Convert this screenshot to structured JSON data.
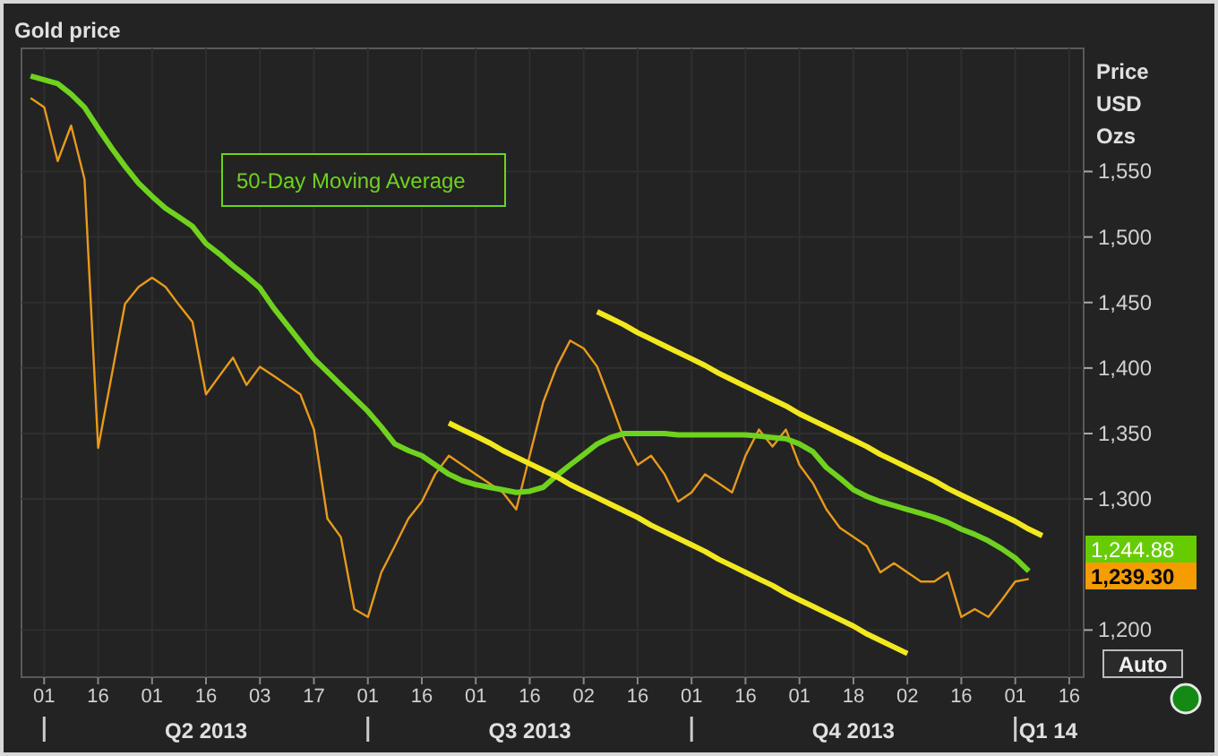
{
  "chart": {
    "axis_title": [
      "Price",
      "USD",
      "Ozs"
    ],
    "chart_data": {
      "type": "line",
      "title": "Gold price",
      "ylim": [
        1164,
        1644
      ],
      "categories": [
        null,
        "01",
        null,
        null,
        null,
        "16",
        null,
        null,
        null,
        "01",
        null,
        null,
        null,
        "16",
        null,
        null,
        null,
        "03",
        null,
        null,
        null,
        "17",
        null,
        null,
        null,
        "01",
        null,
        null,
        null,
        "16",
        null,
        null,
        null,
        "01",
        null,
        null,
        null,
        "16",
        null,
        null,
        null,
        "02",
        null,
        null,
        null,
        "16",
        null,
        null,
        null,
        "01",
        null,
        null,
        null,
        "16",
        null,
        null,
        null,
        "01",
        null,
        null,
        null,
        "18",
        null,
        null,
        null,
        "02",
        null,
        null,
        null,
        "16",
        null,
        null,
        null,
        "01",
        null,
        null,
        null,
        "16"
      ],
      "yticks": [
        {
          "value": 1200,
          "label": "1,200"
        },
        {
          "value": 1300,
          "label": "1,300"
        },
        {
          "value": 1350,
          "label": "1,350"
        },
        {
          "value": 1400,
          "label": "1,400"
        },
        {
          "value": 1450,
          "label": "1,450"
        },
        {
          "value": 1500,
          "label": "1,500"
        },
        {
          "value": 1550,
          "label": "1,550"
        }
      ],
      "series": [
        {
          "color": "#e89a1c",
          "values": [
            1606,
            1599,
            1558,
            1585,
            1544,
            1339,
            1394,
            1449,
            1462,
            1469,
            1462,
            1448,
            1435,
            1380,
            1394,
            1408,
            1387,
            1401,
            1394,
            1387,
            1380,
            1353,
            1285,
            1271,
            1216,
            1210,
            1244,
            1264,
            1285,
            1298,
            1319,
            1333,
            1326,
            1319,
            1312,
            1305,
            1292,
            1333,
            1374,
            1401,
            1421,
            1415,
            1401,
            1374,
            1346,
            1326,
            1333,
            1319,
            1298,
            1305,
            1319,
            1312,
            1305,
            1333,
            1353,
            1340,
            1353,
            1326,
            1312,
            1292,
            1278,
            1271,
            1264,
            1244,
            1251,
            1244,
            1237,
            1237,
            1244,
            1210,
            1216,
            1210,
            1223,
            1237,
            1239,
            null,
            null,
            null
          ]
        },
        {
          "name": "50-Day Moving Average",
          "color": "#6fd21e",
          "values": [
            1623,
            1620,
            1617,
            1609,
            1599,
            1583,
            1568,
            1554,
            1541,
            1531,
            1522,
            1515,
            1508,
            1495,
            1487,
            1478,
            1470,
            1461,
            1446,
            1433,
            1420,
            1407,
            1397,
            1387,
            1377,
            1367,
            1355,
            1342,
            1337,
            1333,
            1326,
            1319,
            1314,
            1311,
            1309,
            1307,
            1305,
            1306,
            1309,
            1318,
            1326,
            1334,
            1342,
            1347,
            1350,
            1350,
            1350,
            1350,
            1349,
            1349,
            1349,
            1349,
            1349,
            1349,
            1348,
            1347,
            1346,
            1342,
            1336,
            1324,
            1316,
            1307,
            1302,
            1298,
            1295,
            1292,
            1289,
            1286,
            1282,
            1277,
            1273,
            1268,
            1262,
            1255,
            1245,
            null,
            null,
            null
          ]
        },
        {
          "color": "#f2e81e",
          "values": [
            null,
            null,
            null,
            null,
            null,
            null,
            null,
            null,
            null,
            null,
            null,
            null,
            null,
            null,
            null,
            null,
            null,
            null,
            null,
            null,
            null,
            null,
            null,
            null,
            null,
            null,
            null,
            null,
            null,
            null,
            null,
            null,
            null,
            null,
            null,
            null,
            null,
            null,
            null,
            null,
            null,
            null,
            1443,
            1438,
            1433,
            1427,
            1422,
            1417,
            1412,
            1407,
            1402,
            1396,
            1391,
            1386,
            1381,
            1376,
            1371,
            1365,
            1360,
            1355,
            1350,
            1345,
            1340,
            1334,
            1329,
            1324,
            1319,
            1314,
            1308,
            1303,
            1298,
            1293,
            1288,
            1283,
            1277,
            1272,
            null,
            null
          ]
        },
        {
          "color": "#f2e81e",
          "values": [
            null,
            null,
            null,
            null,
            null,
            null,
            null,
            null,
            null,
            null,
            null,
            null,
            null,
            null,
            null,
            null,
            null,
            null,
            null,
            null,
            null,
            null,
            null,
            null,
            null,
            null,
            null,
            null,
            null,
            null,
            null,
            1358,
            1353,
            1348,
            1343,
            1337,
            1332,
            1327,
            1322,
            1317,
            1311,
            1306,
            1301,
            1296,
            1291,
            1286,
            1280,
            1275,
            1270,
            1265,
            1260,
            1254,
            1249,
            1244,
            1239,
            1234,
            1228,
            1223,
            1218,
            1213,
            1208,
            1203,
            1197,
            1192,
            1187,
            1182,
            null,
            null,
            null,
            null,
            null,
            null,
            null,
            null,
            null,
            null,
            null,
            null
          ]
        }
      ],
      "grid": true
    },
    "price_tags": [
      {
        "text": "1,244.88",
        "kind": "average",
        "color": "#66cc00"
      },
      {
        "text": "1,239.30",
        "kind": "last",
        "color": "#f59c00"
      }
    ],
    "periods": [
      {
        "label": "Q2 2013"
      },
      {
        "label": "Q3 2013"
      },
      {
        "label": "Q4 2013"
      },
      {
        "label": "Q1 14"
      }
    ],
    "scale_button": "Auto"
  }
}
